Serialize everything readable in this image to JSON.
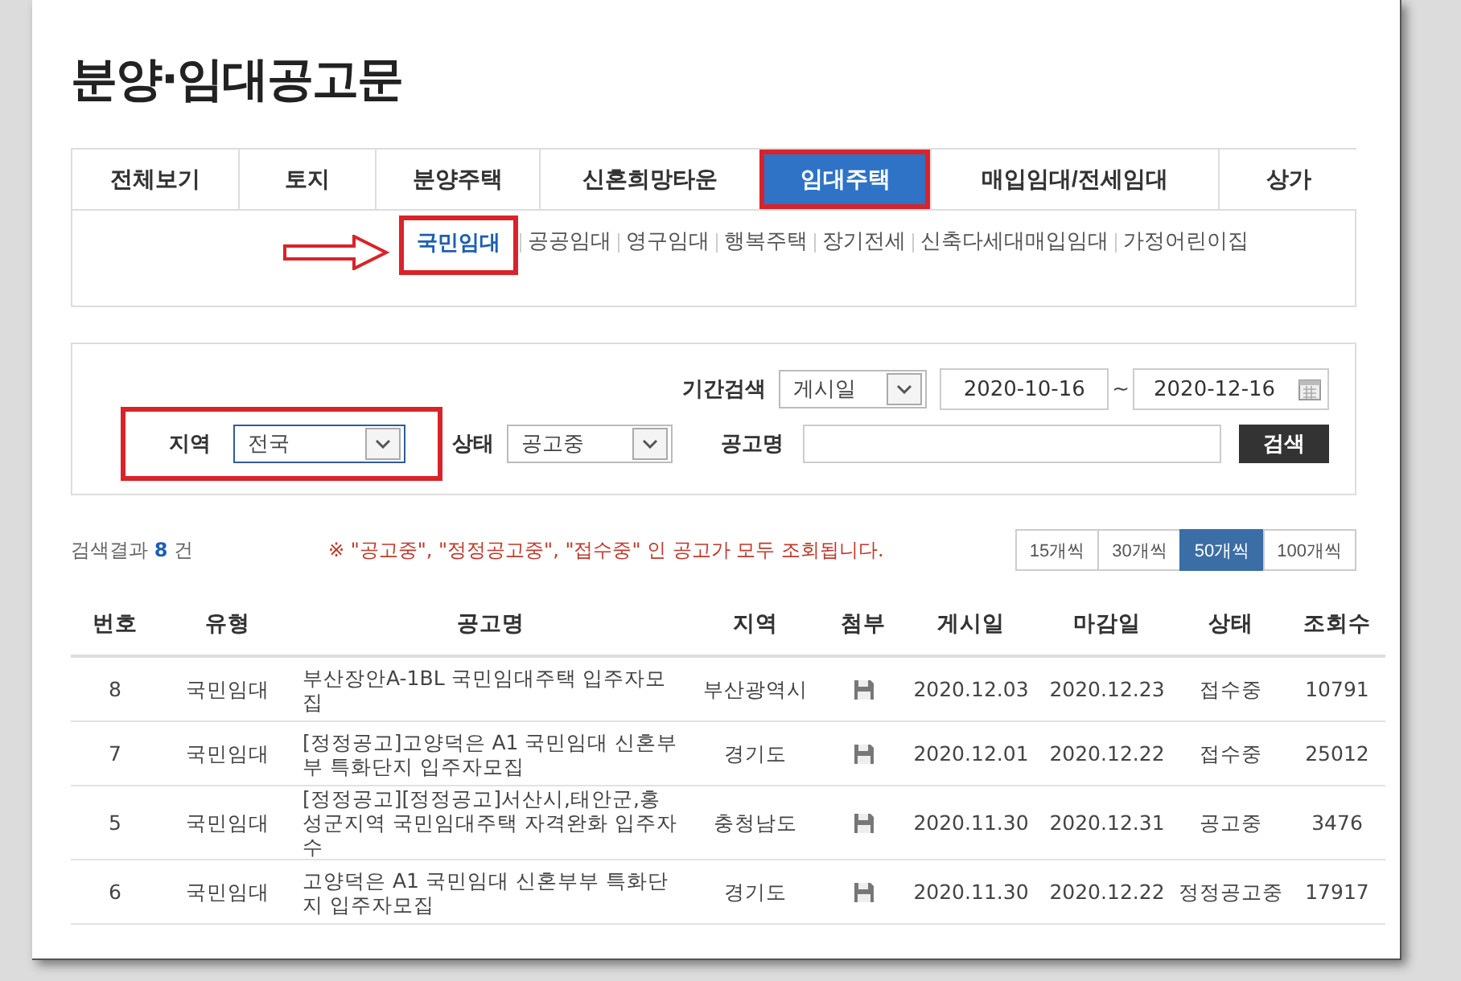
{
  "title": "분양·임대공고문",
  "tabs": [
    {
      "label": "전체보기",
      "selected": false,
      "highlighted": false
    },
    {
      "label": "토지",
      "selected": false,
      "highlighted": false
    },
    {
      "label": "분양주택",
      "selected": false,
      "highlighted": false
    },
    {
      "label": "신혼희망타운",
      "selected": false,
      "highlighted": false
    },
    {
      "label": "임대주택",
      "selected": true,
      "highlighted": true
    },
    {
      "label": "매입임대/전세임대",
      "selected": false,
      "highlighted": false
    },
    {
      "label": "상가",
      "selected": false,
      "highlighted": false
    }
  ],
  "subtabs": [
    {
      "label": "국민임대",
      "selected": true,
      "highlighted": true
    },
    {
      "label": "공공임대",
      "selected": false,
      "highlighted": false
    },
    {
      "label": "영구임대",
      "selected": false,
      "highlighted": false
    },
    {
      "label": "행복주택",
      "selected": false,
      "highlighted": false
    },
    {
      "label": "장기전세",
      "selected": false,
      "highlighted": false
    },
    {
      "label": "신축다세대매입임대",
      "selected": false,
      "highlighted": false
    },
    {
      "label": "가정어린이집",
      "selected": false,
      "highlighted": false
    }
  ],
  "search": {
    "period_label": "기간검색",
    "period_type": "게시일",
    "date_from": "2020-10-16",
    "date_separator": "~",
    "date_to": "2020-12-16",
    "region_label": "지역",
    "region": "전국",
    "region_highlighted": true,
    "status_label": "상태",
    "status": "공고중",
    "name_label": "공고명",
    "button": "검색"
  },
  "result": {
    "prefix": "검색결과",
    "count": "8",
    "suffix": "건",
    "notice": "※ \"공고중\", \"정정공고중\", \"접수중\" 인 공고가 모두 조회됩니다."
  },
  "page_sizes": [
    {
      "label": "15개씩",
      "selected": false
    },
    {
      "label": "30개씩",
      "selected": false
    },
    {
      "label": "50개씩",
      "selected": true
    },
    {
      "label": "100개씩",
      "selected": false
    }
  ],
  "table": {
    "columns": [
      "번호",
      "유형",
      "공고명",
      "지역",
      "첨부",
      "게시일",
      "마감일",
      "상태",
      "조회수"
    ],
    "rows": [
      {
        "no": "8",
        "type": "국민임대",
        "name": "부산장안A-1BL 국민임대주택 입주자모집",
        "region": "부산광역시",
        "attachment": true,
        "posted": "2020.12.03",
        "deadline": "2020.12.23",
        "status": "접수중",
        "views": "10791"
      },
      {
        "no": "7",
        "type": "국민임대",
        "name": "[정정공고]고양덕은 A1 국민임대 신혼부부 특화단지 입주자모집",
        "region": "경기도",
        "attachment": true,
        "posted": "2020.12.01",
        "deadline": "2020.12.22",
        "status": "접수중",
        "views": "25012"
      },
      {
        "no": "5",
        "type": "국민임대",
        "name": "[정정공고][정정공고]서산시,태안군,홍성군지역 국민임대주택 자격완화 입주자 수",
        "region": "충청남도",
        "attachment": true,
        "posted": "2020.11.30",
        "deadline": "2020.12.31",
        "status": "공고중",
        "views": "3476"
      },
      {
        "no": "6",
        "type": "국민임대",
        "name": "고양덕은 A1 국민임대 신혼부부 특화단지 입주자모집",
        "region": "경기도",
        "attachment": true,
        "posted": "2020.11.30",
        "deadline": "2020.12.22",
        "status": "정정공고중",
        "views": "17917"
      }
    ]
  }
}
